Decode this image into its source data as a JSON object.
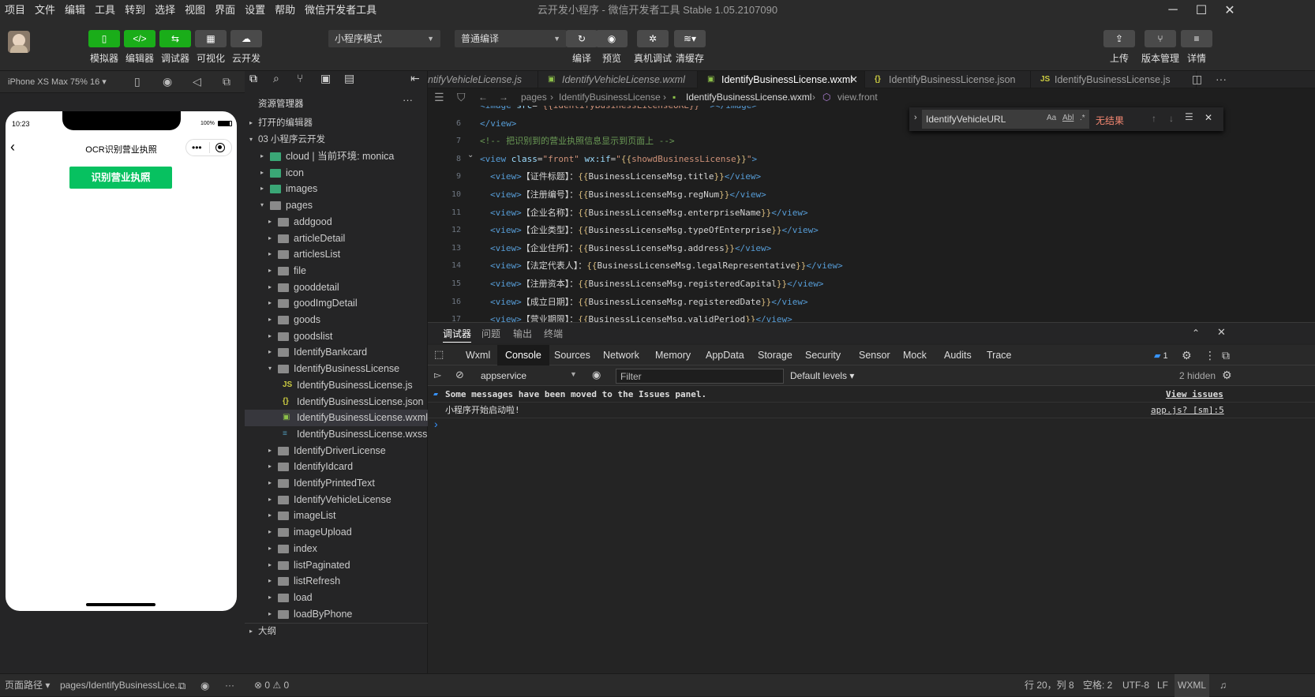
{
  "menu": [
    "项目",
    "文件",
    "编辑",
    "工具",
    "转到",
    "选择",
    "视图",
    "界面",
    "设置",
    "帮助",
    "微信开发者工具"
  ],
  "window_title": "云开发小程序 - 微信开发者工具 Stable 1.05.2107090",
  "toolbar": {
    "left_buttons": [
      "模拟器",
      "编辑器",
      "调试器",
      "可视化",
      "云开发"
    ],
    "mode_select": "小程序模式",
    "compile_select": "普通编译",
    "mid_buttons": [
      "编译",
      "预览",
      "真机调试",
      "清缓存"
    ],
    "right_buttons": [
      "上传",
      "版本管理",
      "详情"
    ]
  },
  "simulator": {
    "device": "iPhone XS Max 75% 16 ▾",
    "time": "10:23",
    "battery": "100%",
    "page_title": "OCR识别营业执照",
    "action_button": "识别营业执照"
  },
  "explorer": {
    "title": "资源管理器",
    "open_editors": "打开的编辑器",
    "project": "03 小程序云开发",
    "items": [
      {
        "label": "cloud | 当前环境: monica",
        "depth": 1,
        "type": "folder-special",
        "arrow": "▸"
      },
      {
        "label": "icon",
        "depth": 1,
        "type": "folder-special",
        "arrow": "▸"
      },
      {
        "label": "images",
        "depth": 1,
        "type": "folder-special",
        "arrow": "▸"
      },
      {
        "label": "pages",
        "depth": 1,
        "type": "folder-open",
        "arrow": "▾"
      },
      {
        "label": "addgood",
        "depth": 2,
        "type": "folder",
        "arrow": "▸"
      },
      {
        "label": "articleDetail",
        "depth": 2,
        "type": "folder",
        "arrow": "▸"
      },
      {
        "label": "articlesList",
        "depth": 2,
        "type": "folder",
        "arrow": "▸"
      },
      {
        "label": "file",
        "depth": 2,
        "type": "folder",
        "arrow": "▸"
      },
      {
        "label": "gooddetail",
        "depth": 2,
        "type": "folder",
        "arrow": "▸"
      },
      {
        "label": "goodImgDetail",
        "depth": 2,
        "type": "folder",
        "arrow": "▸"
      },
      {
        "label": "goods",
        "depth": 2,
        "type": "folder",
        "arrow": "▸"
      },
      {
        "label": "goodslist",
        "depth": 2,
        "type": "folder",
        "arrow": "▸"
      },
      {
        "label": "IdentifyBankcard",
        "depth": 2,
        "type": "folder",
        "arrow": "▸"
      },
      {
        "label": "IdentifyBusinessLicense",
        "depth": 2,
        "type": "folder",
        "arrow": "▾"
      },
      {
        "label": "IdentifyBusinessLicense.js",
        "depth": 3,
        "type": "js",
        "arrow": ""
      },
      {
        "label": "IdentifyBusinessLicense.json",
        "depth": 3,
        "type": "json",
        "arrow": ""
      },
      {
        "label": "IdentifyBusinessLicense.wxml",
        "depth": 3,
        "type": "wxml",
        "arrow": "",
        "selected": true
      },
      {
        "label": "IdentifyBusinessLicense.wxss",
        "depth": 3,
        "type": "wxss",
        "arrow": ""
      },
      {
        "label": "IdentifyDriverLicense",
        "depth": 2,
        "type": "folder",
        "arrow": "▸"
      },
      {
        "label": "IdentifyIdcard",
        "depth": 2,
        "type": "folder",
        "arrow": "▸"
      },
      {
        "label": "IdentifyPrintedText",
        "depth": 2,
        "type": "folder",
        "arrow": "▸"
      },
      {
        "label": "IdentifyVehicleLicense",
        "depth": 2,
        "type": "folder",
        "arrow": "▸"
      },
      {
        "label": "imageList",
        "depth": 2,
        "type": "folder",
        "arrow": "▸"
      },
      {
        "label": "imageUpload",
        "depth": 2,
        "type": "folder",
        "arrow": "▸"
      },
      {
        "label": "index",
        "depth": 2,
        "type": "folder",
        "arrow": "▸"
      },
      {
        "label": "listPaginated",
        "depth": 2,
        "type": "folder",
        "arrow": "▸"
      },
      {
        "label": "listRefresh",
        "depth": 2,
        "type": "folder",
        "arrow": "▸"
      },
      {
        "label": "load",
        "depth": 2,
        "type": "folder",
        "arrow": "▸"
      },
      {
        "label": "loadByPhone",
        "depth": 2,
        "type": "folder",
        "arrow": "▸"
      }
    ],
    "outline": "大纲"
  },
  "tabs": [
    {
      "label": "ntifyVehicleLicense.js",
      "type": "js",
      "italic": true
    },
    {
      "label": "IdentifyVehicleLicense.wxml",
      "type": "wxml",
      "italic": true
    },
    {
      "label": "IdentifyBusinessLicense.wxml",
      "type": "wxml",
      "active": true
    },
    {
      "label": "IdentifyBusinessLicense.json",
      "type": "json"
    },
    {
      "label": "IdentifyBusinessLicense.js",
      "type": "js"
    }
  ],
  "breadcrumb": [
    "pages",
    "IdentifyBusinessLicense",
    "IdentifyBusinessLicense.wxml",
    "view.front"
  ],
  "code_lines": [
    {
      "n": "",
      "html": "<span class='kw'>&lt;image</span> <span class='ex'>src</span>=<span class='str'>\"{{identifyBusinessLicenseURL}}\"</span> <span class='kw'>&gt;&lt;/image&gt;</span>",
      "indent": 0
    },
    {
      "n": "6",
      "html": "<span class='kw'>&lt;/view&gt;</span>",
      "indent": 0
    },
    {
      "n": "7",
      "html": "<span class='cm'>&lt;!-- 把识别到的营业执照信息显示到页面上 --&gt;</span>",
      "indent": 0
    },
    {
      "n": "8",
      "html": "<span class='kw'>&lt;view</span> <span class='ex'>class</span>=<span class='str'>\"front\"</span> <span class='ex'>wx:if</span>=<span class='str'>\"<span class='br'>{{</span>showdBusinessLicense<span class='br'>}}</span>\"</span><span class='kw'>&gt;</span>",
      "indent": 0
    },
    {
      "n": "9",
      "html": "<span class='kw'>&lt;view&gt;</span><span class='pl'>【证件标题】：</span><span class='br'>{{</span><span class='pl'>BusinessLicenseMsg.title</span><span class='br'>}}</span><span class='kw'>&lt;/view&gt;</span>",
      "indent": 1
    },
    {
      "n": "10",
      "html": "<span class='kw'>&lt;view&gt;</span><span class='pl'>【注册编号】：</span><span class='br'>{{</span><span class='pl'>BusinessLicenseMsg.regNum</span><span class='br'>}}</span><span class='kw'>&lt;/view&gt;</span>",
      "indent": 1
    },
    {
      "n": "11",
      "html": "<span class='kw'>&lt;view&gt;</span><span class='pl'>【企业名称】：</span><span class='br'>{{</span><span class='pl'>BusinessLicenseMsg.enterpriseName</span><span class='br'>}}</span><span class='kw'>&lt;/view&gt;</span>",
      "indent": 1
    },
    {
      "n": "12",
      "html": "<span class='kw'>&lt;view&gt;</span><span class='pl'>【企业类型】：</span><span class='br'>{{</span><span class='pl'>BusinessLicenseMsg.typeOfEnterprise</span><span class='br'>}}</span><span class='kw'>&lt;/view&gt;</span>",
      "indent": 1
    },
    {
      "n": "13",
      "html": "<span class='kw'>&lt;view&gt;</span><span class='pl'>【企业住所】：</span><span class='br'>{{</span><span class='pl'>BusinessLicenseMsg.address</span><span class='br'>}}</span><span class='kw'>&lt;/view&gt;</span>",
      "indent": 1
    },
    {
      "n": "14",
      "html": "<span class='kw'>&lt;view&gt;</span><span class='pl'>【法定代表人】：</span><span class='br'>{{</span><span class='pl'>BusinessLicenseMsg.legalRepresentative</span><span class='br'>}}</span><span class='kw'>&lt;/view&gt;</span>",
      "indent": 1
    },
    {
      "n": "15",
      "html": "<span class='kw'>&lt;view&gt;</span><span class='pl'>【注册资本】：</span><span class='br'>{{</span><span class='pl'>BusinessLicenseMsg.registeredCapital</span><span class='br'>}}</span><span class='kw'>&lt;/view&gt;</span>",
      "indent": 1
    },
    {
      "n": "16",
      "html": "<span class='kw'>&lt;view&gt;</span><span class='pl'>【成立日期】：</span><span class='br'>{{</span><span class='pl'>BusinessLicenseMsg.registeredDate</span><span class='br'>}}</span><span class='kw'>&lt;/view&gt;</span>",
      "indent": 1
    },
    {
      "n": "17",
      "html": "<span class='kw'>&lt;view&gt;</span><span class='pl'>【营业期限】：</span><span class='br'>{{</span><span class='pl'>BusinessLicenseMsg.validPeriod</span><span class='br'>}}</span><span class='kw'>&lt;/view&gt;</span>",
      "indent": 1
    }
  ],
  "find": {
    "value": "IdentifyVehicleURL",
    "opt1": "Aa",
    "opt2": "Abl",
    "opt3": ".*",
    "result": "无结果"
  },
  "devtools": {
    "top_tabs": [
      "调试器",
      "问题",
      "输出",
      "终端"
    ],
    "nav_tabs": [
      "Wxml",
      "Console",
      "Sources",
      "Network",
      "Memory",
      "AppData",
      "Storage",
      "Security",
      "Sensor",
      "Mock",
      "Audits",
      "Trace"
    ],
    "active_nav": "Console",
    "issues_count": "1",
    "context": "appservice",
    "filter_placeholder": "Filter",
    "levels": "Default levels",
    "hidden": "2 hidden",
    "messages": [
      {
        "text": "Some messages have been moved to the Issues panel.",
        "link": "View issues",
        "bold": true
      },
      {
        "text": "小程序开始启动啦!",
        "link": "app.js? [sm]:5"
      }
    ],
    "prompt": "›"
  },
  "status": {
    "path_label": "页面路径 ▾",
    "path": "pages/IdentifyBusinessLice...",
    "problems": "⊗ 0 ⚠ 0",
    "cursor": "行 20，列 8",
    "spaces": "空格: 2",
    "encoding": "UTF-8",
    "eol": "LF",
    "lang": "WXML"
  },
  "colors": {
    "accent": "#1aad19",
    "link": "#3794ff",
    "error": "#f48771"
  }
}
